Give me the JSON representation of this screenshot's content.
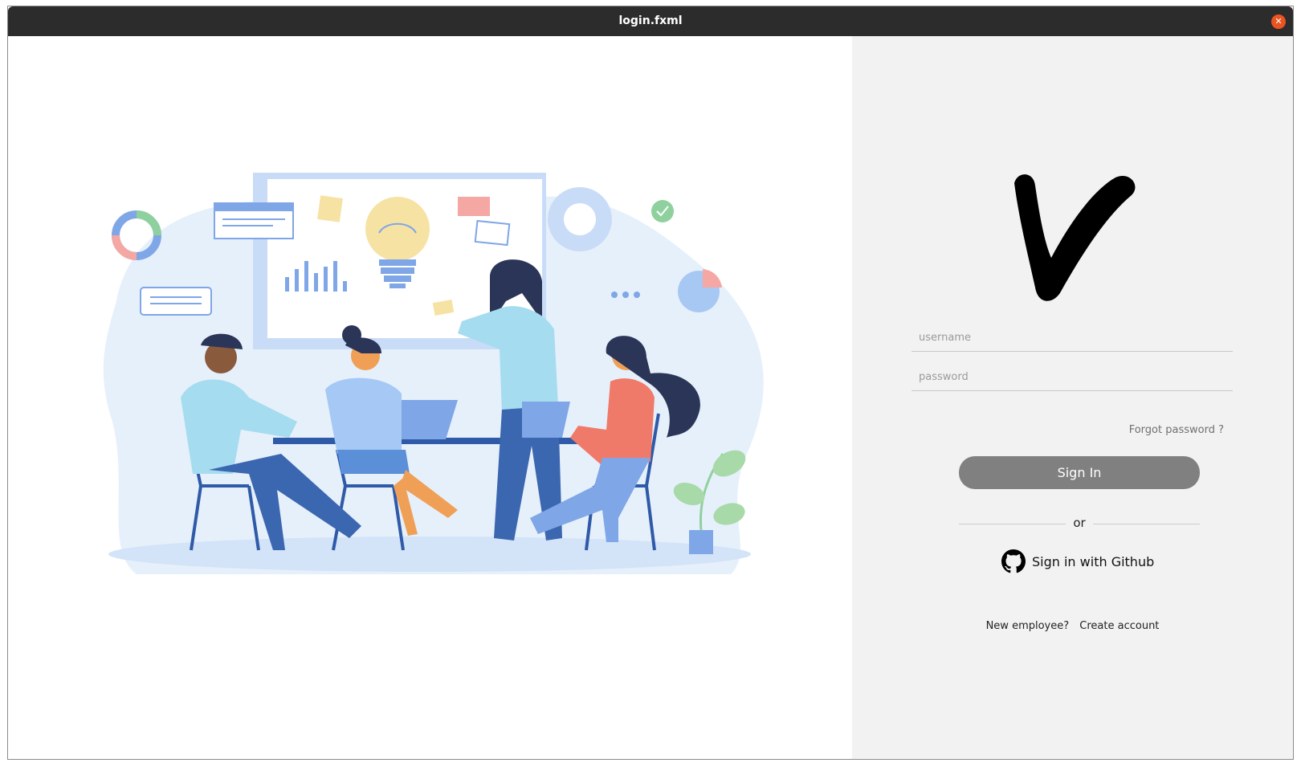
{
  "window": {
    "title": "login.fxml",
    "close_symbol": "✕"
  },
  "login": {
    "username_placeholder": "username",
    "password_placeholder": "password",
    "forgot_label": "Forgot password ?",
    "signin_label": "Sign In",
    "or_label": "or",
    "github_label": "Sign in with Github",
    "new_employee_label": "New employee?",
    "create_account_label": "Create account"
  },
  "icons": {
    "logo": "v-logo-icon",
    "github": "github-icon",
    "close": "close-icon"
  },
  "colors": {
    "titlebar": "#2c2c2c",
    "close": "#e95420",
    "signin_button": "#808080",
    "panel_background": "#f2f2f2"
  }
}
